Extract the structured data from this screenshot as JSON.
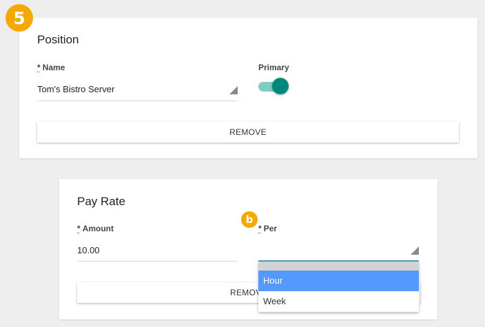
{
  "badges": {
    "step": "5",
    "callout": "b"
  },
  "position": {
    "title": "Position",
    "name_required": "*",
    "name_label": "Name",
    "name_value": "Tom's Bistro Server",
    "primary_label": "Primary",
    "primary_on": true,
    "remove_label": "REMOVE"
  },
  "pay_rate": {
    "title": "Pay Rate",
    "amount_required": "*",
    "amount_label": "Amount",
    "amount_value": "10.00",
    "per_required": "*",
    "per_label": "Per",
    "per_value": "",
    "remove_label": "REMOVE",
    "per_options": [
      {
        "label": "Hour",
        "selected": true
      },
      {
        "label": "Week",
        "selected": false
      }
    ]
  },
  "colors": {
    "badge": "#f5a800",
    "toggle_track": "#80cbc4",
    "toggle_knob": "#00897b",
    "selected_option": "#5599ff",
    "focus_underline": "#5a9ab5"
  },
  "icons": {
    "select_caret": "triangle-corner-icon"
  }
}
